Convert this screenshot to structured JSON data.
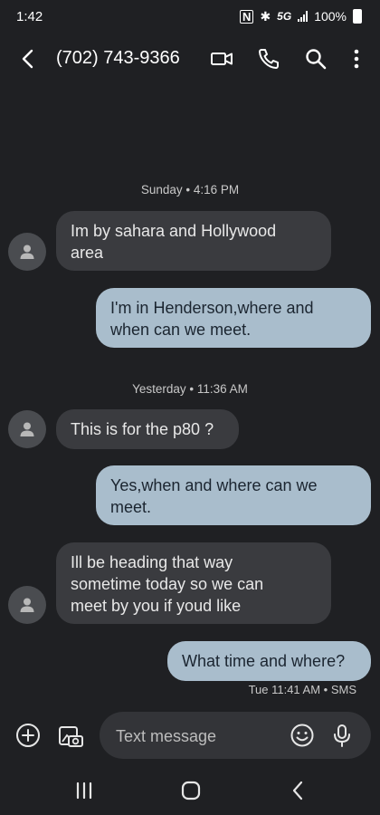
{
  "status": {
    "time": "1:42",
    "network": "5G",
    "battery": "100%"
  },
  "header": {
    "contact": "(702) 743-9366"
  },
  "conversation": {
    "sep1": "Sunday • 4:16 PM",
    "msg1": [
      "Im by sahara and Hollywood",
      "area"
    ],
    "msg2": [
      "I'm in Henderson,where and",
      "when can we meet."
    ],
    "sep2": "Yesterday • 11:36 AM",
    "msg3": "This is for the p80 ?",
    "msg4": [
      "Yes,when and where can we",
      "meet."
    ],
    "msg5": [
      "Ill be heading that way",
      "sometime today so we can",
      "meet by you if youd like"
    ],
    "msg6": "What time and where?",
    "msg6_meta": "Tue 11:41 AM • SMS"
  },
  "composer": {
    "placeholder": "Text message"
  },
  "colors": {
    "background": "#1f2023",
    "incoming_bubble": "#3a3b3f",
    "outgoing_bubble": "#a9bdcc"
  },
  "icons": [
    "back-icon",
    "video-call-icon",
    "phone-icon",
    "search-icon",
    "more-vert-icon",
    "add-icon",
    "gallery-icon",
    "emoji-icon",
    "mic-icon",
    "recents-icon",
    "home-icon",
    "nav-back-icon"
  ]
}
